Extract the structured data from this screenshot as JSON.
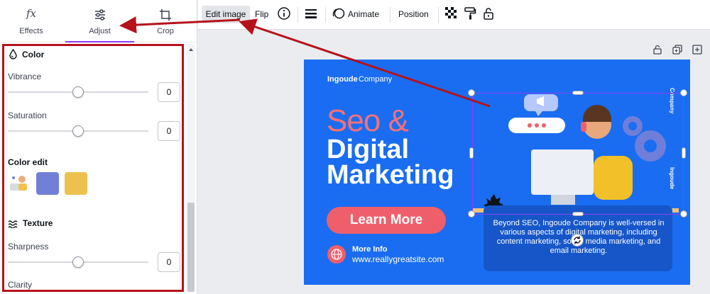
{
  "tabs": {
    "effects": "Effects",
    "adjust": "Adjust",
    "crop": "Crop"
  },
  "panel": {
    "color_title": "Color",
    "vibrance": {
      "label": "Vibrance",
      "value": "0",
      "level": 0.5
    },
    "saturation": {
      "label": "Saturation",
      "value": "0",
      "level": 0.5
    },
    "color_edit_title": "Color edit",
    "swatches": [
      "#7180d6",
      "#ecc14f"
    ],
    "texture_title": "Texture",
    "sharpness": {
      "label": "Sharpness",
      "value": "0",
      "level": 0.5
    },
    "clarity": {
      "label": "Clarity"
    }
  },
  "toolbar": {
    "edit_image": "Edit image",
    "flip": "Flip",
    "animate": "Animate",
    "position": "Position"
  },
  "design": {
    "brand_bold": "Ingoude",
    "brand_light": "Company",
    "h_seo": "Seo &",
    "h_digital": "Digital",
    "h_marketing": "Marketing",
    "learn_more": "Learn More",
    "more_info": "More Info",
    "site": "www.reallygreatsite.com",
    "description": "Beyond SEO, Ingoude Company is well-versed in various aspects of digital marketing, including content marketing, social media marketing, and email marketing.",
    "side_text_1": "Company",
    "side_text_2": "Ingoude"
  },
  "colors": {
    "accent": "#8b3dff",
    "annotation": "#b5121b",
    "design_bg": "#1a6df0",
    "coral": "#ef5f6b"
  }
}
